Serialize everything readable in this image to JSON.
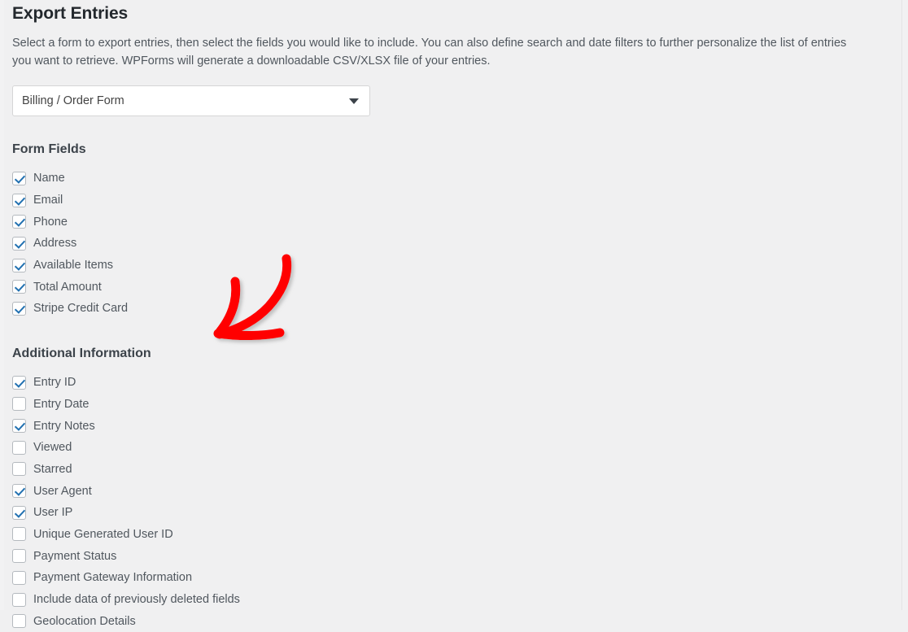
{
  "page": {
    "title": "Export Entries",
    "description": "Select a form to export entries, then select the fields you would like to include. You can also define search and date filters to further personalize the list of entries you want to retrieve. WPForms will generate a downloadable CSV/XLSX file of your entries."
  },
  "form_selector": {
    "selected": "Billing / Order Form",
    "options": [
      "Billing / Order Form"
    ],
    "caret_icon": "chevron-down-icon"
  },
  "form_fields": {
    "title": "Form Fields",
    "items": [
      {
        "label": "Name",
        "checked": true
      },
      {
        "label": "Email",
        "checked": true
      },
      {
        "label": "Phone",
        "checked": true
      },
      {
        "label": "Address",
        "checked": true
      },
      {
        "label": "Available Items",
        "checked": true
      },
      {
        "label": "Total Amount",
        "checked": true
      },
      {
        "label": "Stripe Credit Card",
        "checked": true
      }
    ]
  },
  "additional_information": {
    "title": "Additional Information",
    "items": [
      {
        "label": "Entry ID",
        "checked": true
      },
      {
        "label": "Entry Date",
        "checked": false
      },
      {
        "label": "Entry Notes",
        "checked": true
      },
      {
        "label": "Viewed",
        "checked": false
      },
      {
        "label": "Starred",
        "checked": false
      },
      {
        "label": "User Agent",
        "checked": true
      },
      {
        "label": "User IP",
        "checked": true
      },
      {
        "label": "Unique Generated User ID",
        "checked": false
      },
      {
        "label": "Payment Status",
        "checked": false
      },
      {
        "label": "Payment Gateway Information",
        "checked": false
      },
      {
        "label": "Include data of previously deleted fields",
        "checked": false
      },
      {
        "label": "Geolocation Details",
        "checked": false
      }
    ]
  },
  "annotation": {
    "type": "hand-drawn-arrow",
    "direction": "down-left",
    "color": "#FF0000"
  },
  "colors": {
    "background": "#f0f0f1",
    "heading": "#23282d",
    "section_heading": "#3c434a",
    "body_text": "#50575e",
    "checkbox_check": "#2271b1",
    "checkbox_border": "#b4b9be",
    "input_background": "#ffffff",
    "annotation_red": "#FF0000"
  }
}
